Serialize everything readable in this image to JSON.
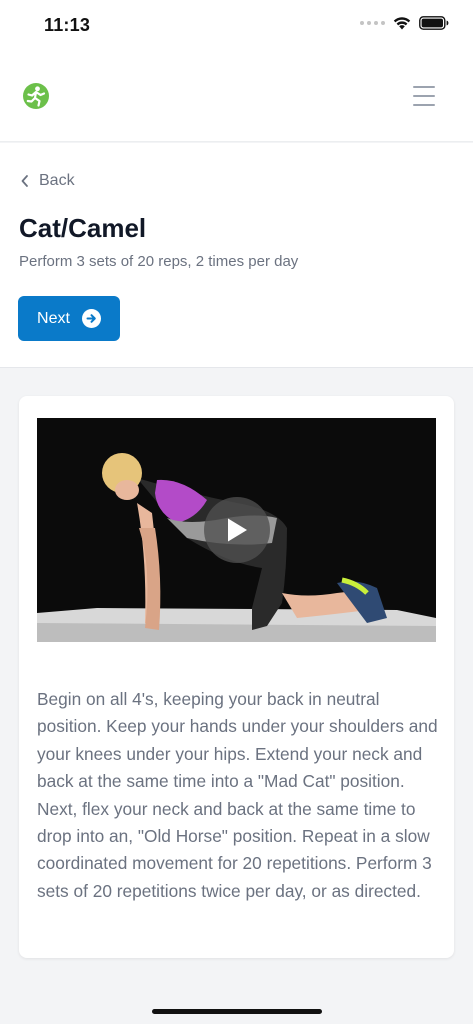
{
  "status_bar": {
    "time": "11:13"
  },
  "header": {
    "logo_icon": "runner-logo-icon",
    "menu_icon": "hamburger-menu-icon"
  },
  "nav": {
    "back_label": "Back"
  },
  "exercise": {
    "title": "Cat/Camel",
    "prescription": "Perform 3 sets of 20 reps, 2 times per day",
    "next_label": "Next",
    "description": "Begin on all 4's, keeping your back in neutral position. Keep your hands under your shoulders and your knees under your hips. Extend your neck and back at the same time into a \"Mad Cat\" position. Next, flex your neck and back at the same time to drop into an, \"Old Horse\" position. Repeat in a slow coordinated movement for 20 repetitions. Perform 3 sets of 20 repetitions twice per day, or as directed."
  },
  "colors": {
    "accent": "#0a7ac9",
    "brand_green": "#6cc04a",
    "background": "#f3f4f6"
  }
}
